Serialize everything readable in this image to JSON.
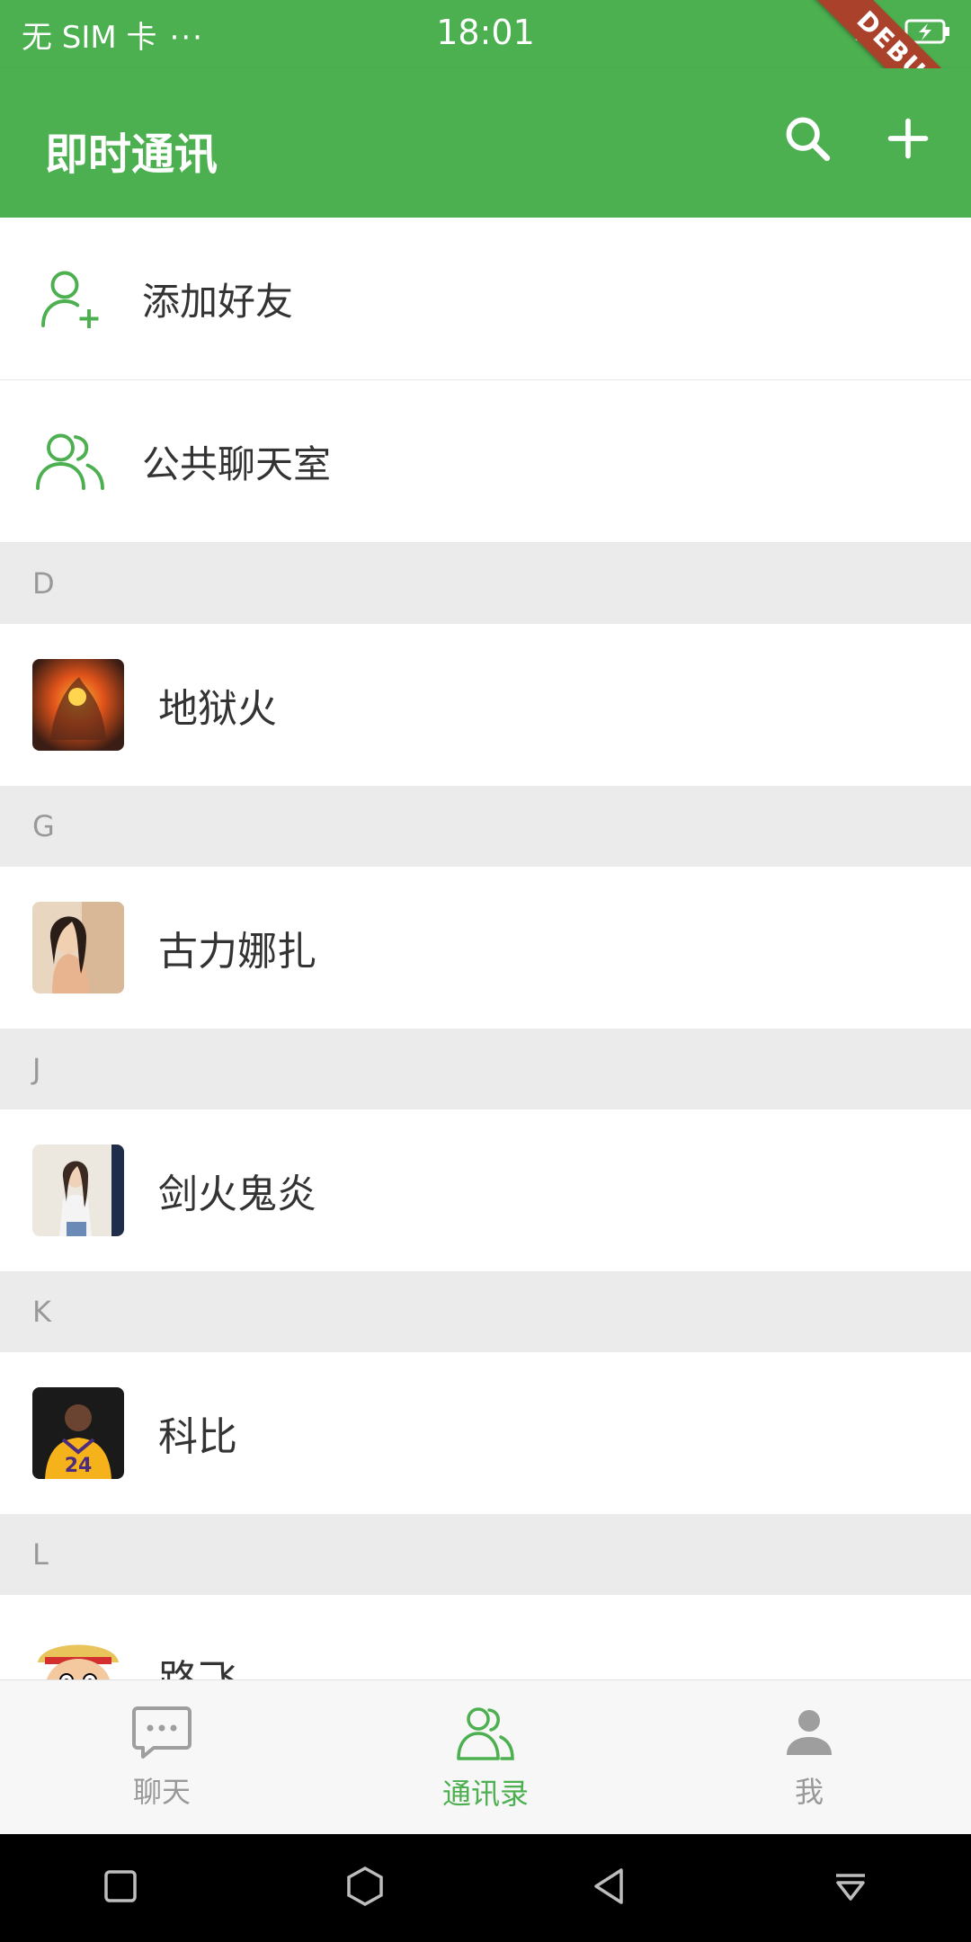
{
  "status_bar": {
    "carrier": "无 SIM 卡",
    "dots": "···",
    "time": "18:01",
    "debug": "DEBUG"
  },
  "app_bar": {
    "title": "即时通讯"
  },
  "actions": [
    {
      "label": "添加好友",
      "icon": "add-user-icon"
    },
    {
      "label": "公共聊天室",
      "icon": "group-icon"
    }
  ],
  "sections": [
    {
      "letter": "D",
      "contacts": [
        {
          "name": "地狱火",
          "avatar": "avatar-fire"
        }
      ]
    },
    {
      "letter": "G",
      "contacts": [
        {
          "name": "古力娜扎",
          "avatar": "avatar-woman"
        }
      ]
    },
    {
      "letter": "J",
      "contacts": [
        {
          "name": "剑火鬼炎",
          "avatar": "avatar-girl"
        }
      ]
    },
    {
      "letter": "K",
      "contacts": [
        {
          "name": "科比",
          "avatar": "avatar-basketball"
        }
      ]
    },
    {
      "letter": "L",
      "contacts": [
        {
          "name": "路飞",
          "avatar": "avatar-cartoon"
        }
      ]
    }
  ],
  "bottom_nav": [
    {
      "label": "聊天",
      "icon": "chat-icon",
      "active": false
    },
    {
      "label": "通讯录",
      "icon": "contacts-icon",
      "active": true
    },
    {
      "label": "我",
      "icon": "person-icon",
      "active": false
    }
  ],
  "colors": {
    "primary": "#4caf50",
    "section_bg": "#ebebeb",
    "inactive": "#999999"
  }
}
